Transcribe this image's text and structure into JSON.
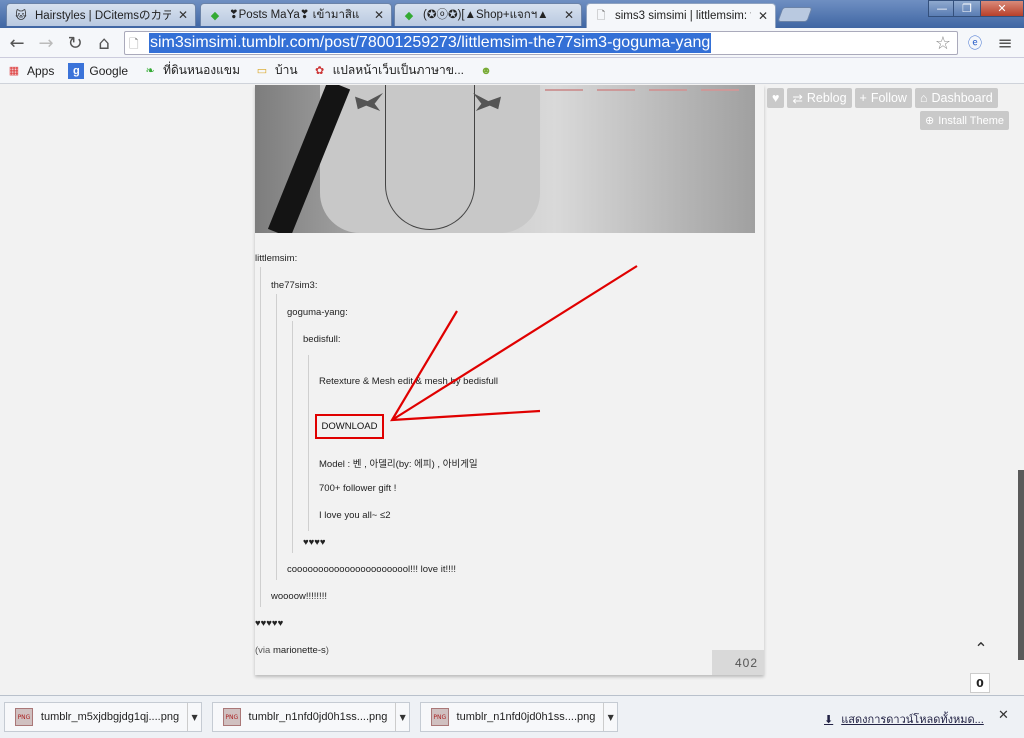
{
  "tabs": [
    {
      "title": "Hairstyles | DCitemsのカテゴ",
      "icon": "cat-icon",
      "active": false
    },
    {
      "title": "❣Posts MaYa❣ เข้ามาสิแ",
      "icon": "diamond-icon",
      "active": false
    },
    {
      "title": "(✪ⓞ✪)[▲Shop+แจกฯ▲",
      "icon": "diamond-icon",
      "active": false
    },
    {
      "title": "sims3 simsimi | littlemsim: the",
      "icon": "page-icon",
      "active": true
    }
  ],
  "address": {
    "url": "sim3simsimi.tumblr.com/post/78001259273/littlemsim-the77sim3-goguma-yang"
  },
  "bookmarks": [
    {
      "label": "Apps",
      "icon": "apps-grid-icon"
    },
    {
      "label": "Google",
      "icon": "google-icon"
    },
    {
      "label": "ที่ดินหนองแขม",
      "icon": "leaf-icon"
    },
    {
      "label": "บ้าน",
      "icon": "folder-icon"
    },
    {
      "label": "แปลหน้าเว็บเป็นภาษาข...",
      "icon": "translate-icon"
    },
    {
      "label": "",
      "icon": "frog-icon"
    }
  ],
  "tumblr_controls": {
    "like_icon": "heart-icon",
    "reblog": "Reblog",
    "follow": "Follow",
    "dashboard": "Dashboard",
    "install_theme": "Install Theme"
  },
  "post": {
    "quotes": {
      "l1": "littlemsim:",
      "l2": "the77sim3:",
      "l3": "goguma-yang:",
      "l4": "bedisfull:",
      "retexture": "Retexture & Mesh edit & mesh by bedisfull",
      "download": "DOWNLOAD",
      "model": "Model : 벤 , 아델리(by: 에피) , 아비게일",
      "gift": "700+ follower gift !",
      "love": "I love you all~ ≤2",
      "hearts4": "♥♥♥♥",
      "cool": "cooooooooooooooooooooool!!! love it!!!!",
      "wooow": "woooow!!!!!!!!",
      "hearts5": "♥♥♥♥♥",
      "via_prefix": "(via",
      "via_link": "marionette-s",
      "via_suffix": ")"
    },
    "notes_count": "402"
  },
  "page_widgets": {
    "counter": "0"
  },
  "downloads": {
    "items": [
      {
        "name": "tumblr_m5xjdbgjdg1qj....png",
        "icon": "png-file-icon"
      },
      {
        "name": "tumblr_n1nfd0jd0h1ss....png",
        "icon": "png-file-icon"
      },
      {
        "name": "tumblr_n1nfd0jd0h1ss....png",
        "icon": "png-file-icon"
      }
    ],
    "show_all": "แสดงการดาวน์โหลดทั้งหมด..."
  },
  "colors": {
    "annotation_red": "#e00000",
    "url_highlight": "#3470d6"
  }
}
